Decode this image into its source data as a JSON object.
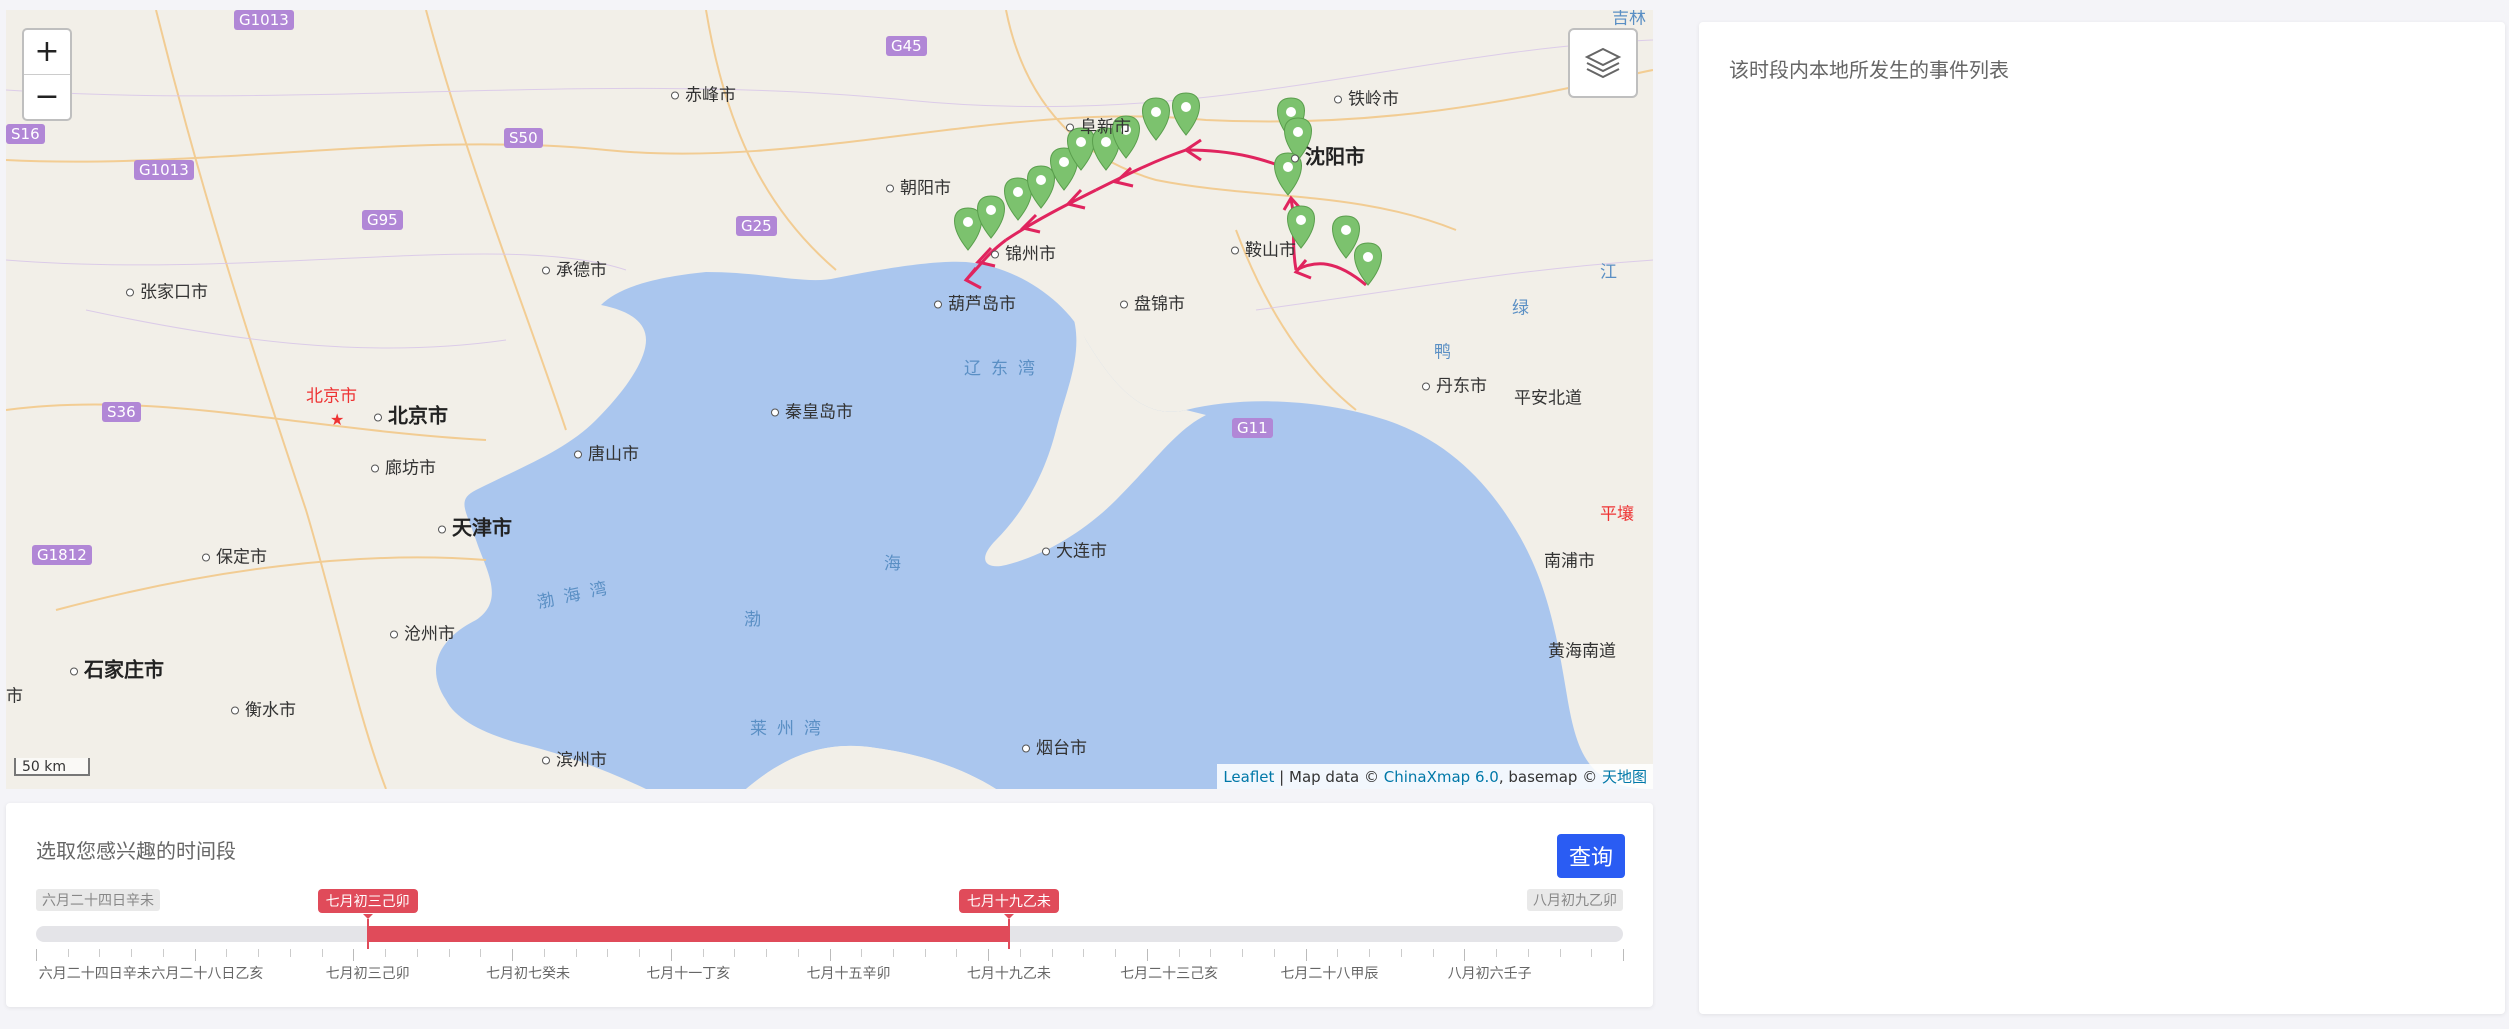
{
  "map": {
    "zoom_in": "+",
    "zoom_out": "−",
    "layers_icon": "layers-icon",
    "scale": "50 km",
    "attribution": {
      "leaflet": "Leaflet",
      "sep1": " | Map data © ",
      "chinaxmap": "ChinaXmap 6.0",
      "sep2": ", basemap © ",
      "tianditu": "天地图"
    },
    "colors": {
      "water": "#aac6ee",
      "land": "#f2efe8",
      "route": "#e0245e",
      "marker": "#7cc26e",
      "shield": "#b187d6"
    },
    "cities": [
      {
        "name": "赤峰市"
      },
      {
        "name": "铁岭市"
      },
      {
        "name": "沈阳市"
      },
      {
        "name": "阜新市"
      },
      {
        "name": "朝阳市"
      },
      {
        "name": "锦州市"
      },
      {
        "name": "鞍山市"
      },
      {
        "name": "葫芦岛市"
      },
      {
        "name": "盘锦市"
      },
      {
        "name": "张家口市"
      },
      {
        "name": "承德市"
      },
      {
        "name": "北京市"
      },
      {
        "name": "廊坊市"
      },
      {
        "name": "唐山市"
      },
      {
        "name": "秦皇岛市"
      },
      {
        "name": "天津市"
      },
      {
        "name": "保定市"
      },
      {
        "name": "沧州市"
      },
      {
        "name": "石家庄市"
      },
      {
        "name": "衡水市"
      },
      {
        "name": "滨州市"
      },
      {
        "name": "大连市"
      },
      {
        "name": "烟台市"
      },
      {
        "name": "丹东市"
      },
      {
        "name": "平安北道"
      },
      {
        "name": "南浦市"
      },
      {
        "name": "黄海南道"
      },
      {
        "name": "平壤"
      },
      {
        "name": "北京市"
      }
    ],
    "seas": [
      "辽东湾",
      "渤海湾",
      "渤",
      "海",
      "莱州湾"
    ],
    "shields": [
      "G1013",
      "G45",
      "S16",
      "G1013",
      "S50",
      "G95",
      "G25",
      "S36",
      "G1812",
      "G11"
    ],
    "side_labels": [
      "吉林",
      "江",
      "绿",
      "鸭",
      "市"
    ]
  },
  "timeline": {
    "title": "选取您感兴趣的时间段",
    "query_button": "查询",
    "min_label": "六月二十四日辛未",
    "max_label": "八月初九乙卯",
    "start_label": "七月初三己卯",
    "end_label": "七月十九乙未",
    "range": {
      "start_fraction": 0.209,
      "end_fraction": 0.613
    },
    "tick_labels": [
      "六月二十四日辛未",
      "六月二十八日乙亥",
      "七月初三己卯",
      "七月初七癸未",
      "七月十一丁亥",
      "七月十五辛卯",
      "七月十九乙未",
      "七月二十三己亥",
      "七月二十八甲辰",
      "八月初六壬子"
    ]
  },
  "events": {
    "title": "该时段内本地所发生的事件列表"
  }
}
